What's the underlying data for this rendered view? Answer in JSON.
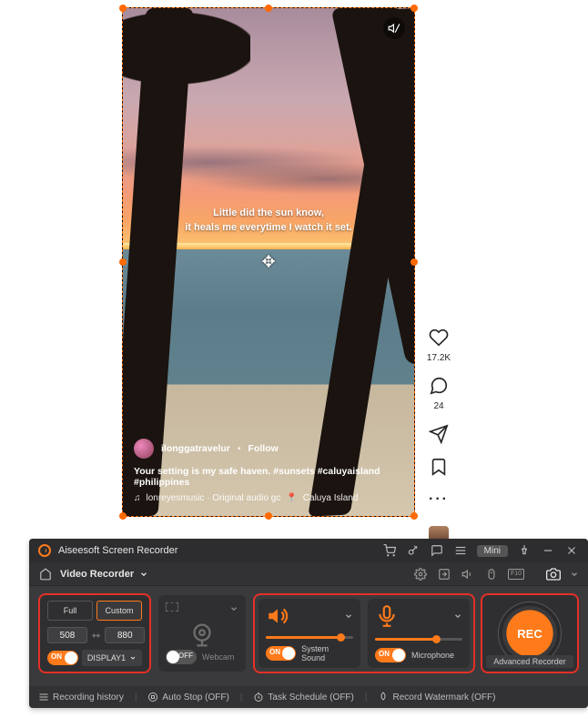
{
  "video": {
    "caption_line1": "Little did the sun know,",
    "caption_line2": "it heals me everytime I watch it set.",
    "username": "ilonggatravelur",
    "follow_label": "Follow",
    "separator": "•",
    "description": "Your setting is my safe haven. #sunsets #caluyaisland #philippines",
    "audio_prefix": "♫",
    "audio_text": "lonreyesmusic · Original audio  gc",
    "location_pin": "●",
    "location": "Caluya Island"
  },
  "social": {
    "likes": "17.2K",
    "comments": "24"
  },
  "app": {
    "title": "Aiseesoft Screen Recorder",
    "mini_label": "Mini"
  },
  "mode": {
    "current": "Video Recorder"
  },
  "area": {
    "full_label": "Full",
    "custom_label": "Custom",
    "width_value": "508",
    "height_value": "880",
    "on_label": "ON",
    "display_label": "DISPLAY1"
  },
  "webcam": {
    "off_label": "OFF",
    "label": "Webcam"
  },
  "system_sound": {
    "on_label": "ON",
    "label": "System Sound",
    "level_pct": 85
  },
  "microphone": {
    "on_label": "ON",
    "label": "Microphone",
    "level_pct": 70
  },
  "rec": {
    "button_label": "REC",
    "advanced_label": "Advanced Recorder"
  },
  "footer": {
    "history": "Recording history",
    "autostop": "Auto Stop (OFF)",
    "schedule": "Task Schedule (OFF)",
    "watermark": "Record Watermark (OFF)"
  }
}
